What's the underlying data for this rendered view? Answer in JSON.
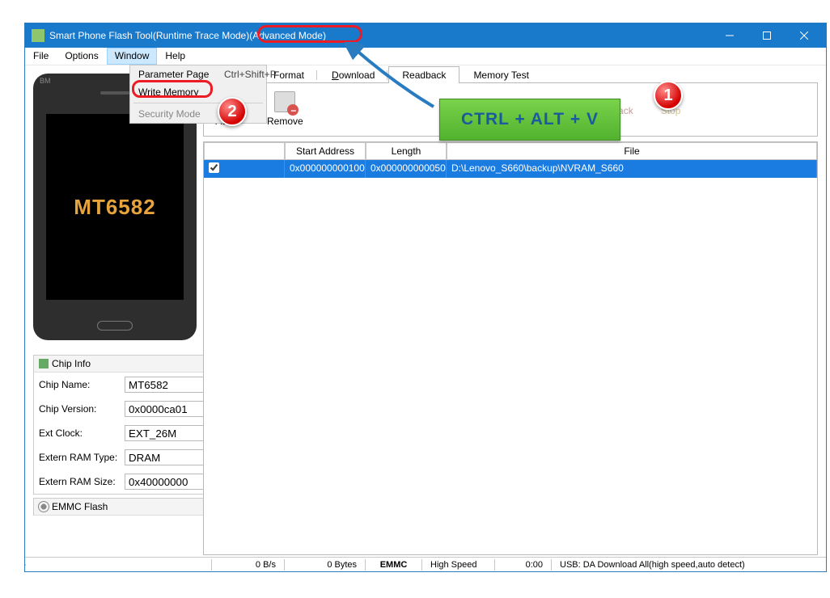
{
  "window": {
    "title": "Smart Phone Flash Tool(Runtime Trace Mode)(Advanced Mode)"
  },
  "menubar": {
    "file": "File",
    "options": "Options",
    "window": "Window",
    "help": "Help"
  },
  "dropdown": {
    "param_label": "Parameter Page",
    "param_key": "Ctrl+Shift+P",
    "write_label": "Write Memory",
    "security_label": "Security Mode"
  },
  "tabs": {
    "format": "Format",
    "download": "Download",
    "readback": "Readback",
    "memorytest": "Memory Test"
  },
  "toolbar": {
    "add": "Add",
    "remove": "Remove",
    "readback": "Read Back",
    "stop": "Stop"
  },
  "grid": {
    "head_start": "Start Address",
    "head_length": "Length",
    "head_file": "File",
    "row0": {
      "start": "0x000000000100...",
      "length": "0x000000000050...",
      "file": "D:\\Lenovo_S660\\backup\\NVRAM_S660"
    }
  },
  "phone": {
    "chip": "MT6582",
    "brand": "BM"
  },
  "chipinfo": {
    "title": "Chip Info",
    "name_lbl": "Chip Name:",
    "name_val": "MT6582",
    "ver_lbl": "Chip Version:",
    "ver_val": "0x0000ca01",
    "clk_lbl": "Ext Clock:",
    "clk_val": "EXT_26M",
    "ramtype_lbl": "Extern RAM Type:",
    "ramtype_val": "DRAM",
    "ramsize_lbl": "Extern RAM Size:",
    "ramsize_val": "0x40000000"
  },
  "emmc": {
    "title": "EMMC Flash"
  },
  "status": {
    "bps": "0 B/s",
    "bytes": "0 Bytes",
    "emmc": "EMMC",
    "speed": "High Speed",
    "time": "0:00",
    "usb": "USB: DA Download All(high speed,auto detect)"
  },
  "hint": {
    "text": "CTRL + ALT + V"
  },
  "badges": {
    "one": "1",
    "two": "2"
  }
}
